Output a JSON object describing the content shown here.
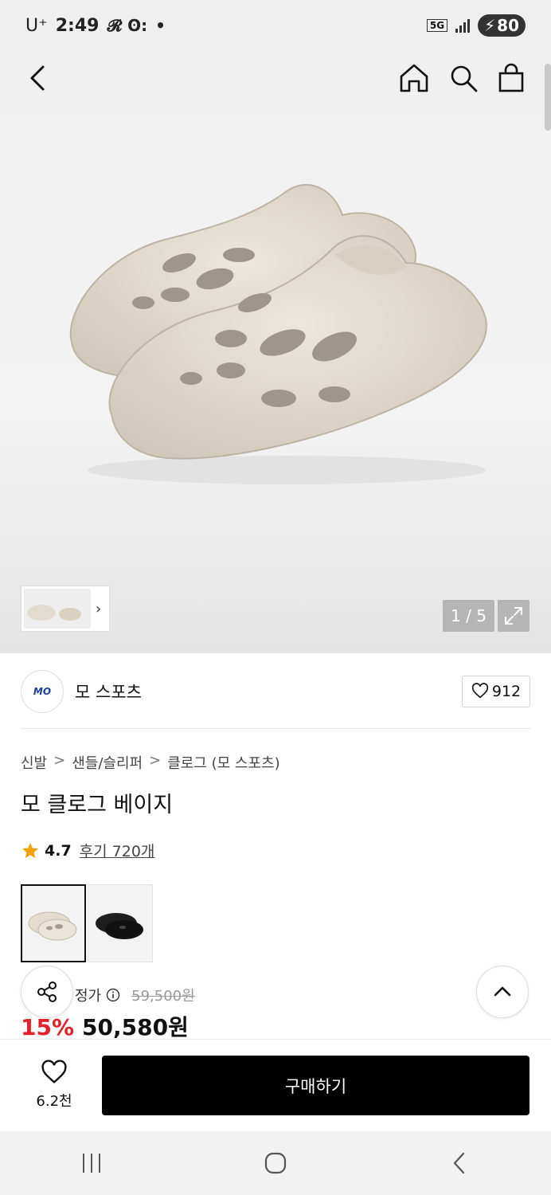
{
  "status_bar": {
    "carrier": "U⁺",
    "time": "2:49",
    "misc_icons": "𝓡 ʘ: ",
    "dot": "•",
    "network": "5G",
    "battery": "80"
  },
  "gallery": {
    "page_indicator": "1 / 5",
    "current_page": 1,
    "total_pages": 5
  },
  "brand": {
    "logo_text": "MO",
    "name": "모 스포츠",
    "likes": "912"
  },
  "breadcrumb": {
    "items": [
      "신발",
      "샌들/슬리퍼",
      "클로그 (모 스포츠)"
    ],
    "separator": ">"
  },
  "product": {
    "title": "모 클로그 베이지",
    "rating": "4.7",
    "reviews": "후기 720개",
    "price_label": "정가",
    "original_price": "59,500원",
    "discount": "15%",
    "sale_price": "50,580원"
  },
  "colors": {
    "accent_red": "#e4202a",
    "buy_button": "#000000",
    "star": "#f5a100"
  },
  "bottom_bar": {
    "wish_count": "6.2천",
    "buy_label": "구매하기"
  },
  "icons": [
    "back-icon",
    "home-icon",
    "search-icon",
    "cart-icon",
    "expand-icon",
    "heart-icon",
    "star-icon",
    "share-icon",
    "chevron-up-icon",
    "recent-apps-icon",
    "home-nav-icon",
    "back-nav-icon"
  ]
}
